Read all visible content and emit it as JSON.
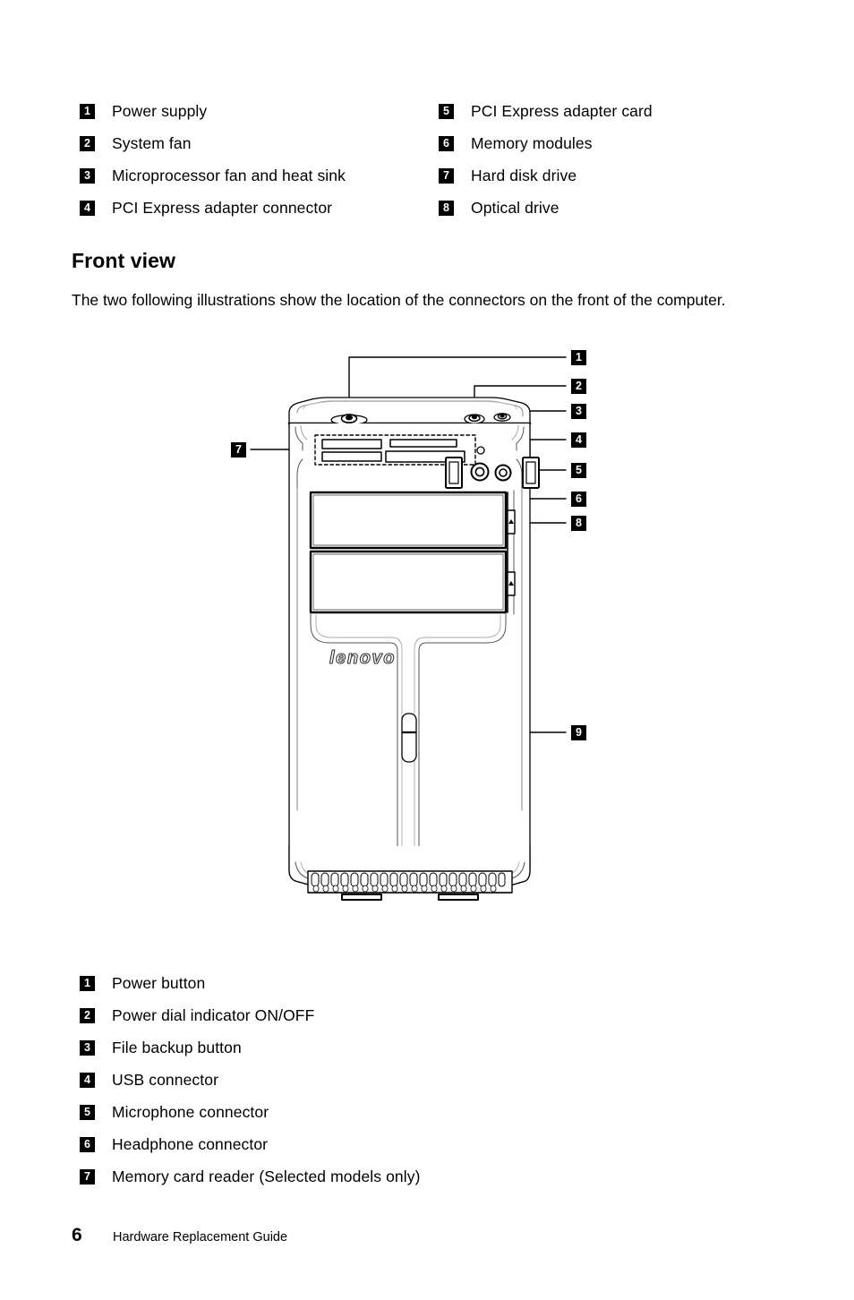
{
  "top_legend": {
    "left_column": [
      {
        "num": "1",
        "label": "Power supply"
      },
      {
        "num": "2",
        "label": "System fan"
      },
      {
        "num": "3",
        "label": "Microprocessor fan and heat sink"
      },
      {
        "num": "4",
        "label": "PCI Express adapter connector"
      }
    ],
    "right_column": [
      {
        "num": "5",
        "label": "PCI Express adapter card"
      },
      {
        "num": "6",
        "label": "Memory modules"
      },
      {
        "num": "7",
        "label": "Hard disk drive"
      },
      {
        "num": "8",
        "label": "Optical drive"
      }
    ]
  },
  "section": {
    "heading": "Front view",
    "paragraph": "The two following illustrations show the location of the connectors on the front of the computer."
  },
  "illustration": {
    "brand_logo": "lenovo",
    "callouts": [
      {
        "num": "1",
        "target": "power-button"
      },
      {
        "num": "2",
        "target": "power-dial-indicator"
      },
      {
        "num": "3",
        "target": "file-backup-button"
      },
      {
        "num": "4",
        "target": "usb-connector"
      },
      {
        "num": "5",
        "target": "microphone-connector"
      },
      {
        "num": "6",
        "target": "headphone-connector"
      },
      {
        "num": "7",
        "target": "memory-card-reader"
      },
      {
        "num": "8",
        "target": "optical-drive"
      },
      {
        "num": "9",
        "target": "front-panel-latch"
      }
    ]
  },
  "bottom_legend": [
    {
      "num": "1",
      "label": "Power button"
    },
    {
      "num": "2",
      "label": "Power dial indicator ON/OFF"
    },
    {
      "num": "3",
      "label": "File backup button"
    },
    {
      "num": "4",
      "label": "USB connector"
    },
    {
      "num": "5",
      "label": "Microphone connector"
    },
    {
      "num": "6",
      "label": "Headphone connector"
    },
    {
      "num": "7",
      "label": "Memory card reader (Selected models only)"
    }
  ],
  "footer": {
    "page_number": "6",
    "title": "Hardware Replacement Guide"
  }
}
